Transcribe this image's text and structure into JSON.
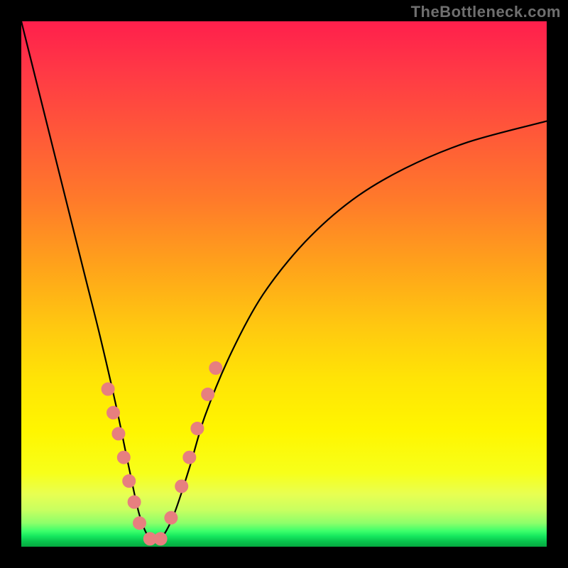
{
  "watermark": "TheBottleneck.com",
  "colors": {
    "curve_stroke": "#000000",
    "marker_fill": "#e77f7f",
    "marker_stroke": "#e77f7f"
  },
  "chart_data": {
    "type": "line",
    "title": "",
    "xlabel": "",
    "ylabel": "",
    "xlim": [
      0,
      1
    ],
    "ylim": [
      0,
      1
    ],
    "note": "Axes are unlabeled in the source; x and y are normalized to [0,1]. The curve is a V-shaped bottleneck plot with minimum near x≈0.25; y values are fractional pixel heights read off the image (1 = top, 0 = bottom).",
    "series": [
      {
        "name": "curve",
        "x": [
          0.0,
          0.03,
          0.06,
          0.09,
          0.12,
          0.15,
          0.18,
          0.205,
          0.225,
          0.245,
          0.265,
          0.29,
          0.32,
          0.35,
          0.4,
          0.46,
          0.54,
          0.63,
          0.73,
          0.85,
          1.0
        ],
        "y": [
          1.0,
          0.88,
          0.76,
          0.64,
          0.52,
          0.4,
          0.27,
          0.15,
          0.06,
          0.015,
          0.015,
          0.06,
          0.15,
          0.25,
          0.37,
          0.48,
          0.58,
          0.66,
          0.72,
          0.77,
          0.81
        ]
      }
    ],
    "markers": {
      "name": "highlighted-points",
      "x": [
        0.165,
        0.175,
        0.185,
        0.195,
        0.205,
        0.215,
        0.225,
        0.245,
        0.265,
        0.285,
        0.305,
        0.32,
        0.335,
        0.355,
        0.37
      ],
      "y": [
        0.3,
        0.255,
        0.215,
        0.17,
        0.125,
        0.085,
        0.045,
        0.015,
        0.015,
        0.055,
        0.115,
        0.17,
        0.225,
        0.29,
        0.34
      ],
      "radius_px": 9
    }
  }
}
